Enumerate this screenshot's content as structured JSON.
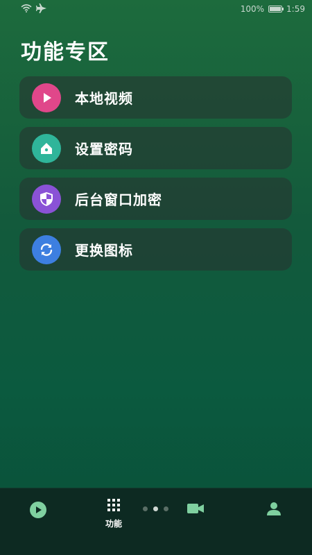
{
  "status_bar": {
    "battery_percent": "100%",
    "time": "1:59",
    "icons": [
      "wifi-icon",
      "airplane-icon",
      "battery-icon"
    ]
  },
  "page_title": "功能专区",
  "menu": [
    {
      "label": "本地视频",
      "icon": "play-icon",
      "color": "#e0478a"
    },
    {
      "label": "设置密码",
      "icon": "home-lock-icon",
      "color": "#2fb59a"
    },
    {
      "label": "后台窗口加密",
      "icon": "shield-icon",
      "color": "#8a52d6"
    },
    {
      "label": "更换图标",
      "icon": "refresh-icon",
      "color": "#3d7fe0"
    }
  ],
  "bottom_nav": {
    "items": [
      {
        "icon": "play-icon",
        "label": ""
      },
      {
        "icon": "grid-icon",
        "label": "功能"
      },
      {
        "icon": "video-camera-icon",
        "label": ""
      },
      {
        "icon": "user-icon",
        "label": ""
      }
    ],
    "accent": "#7fd0a0",
    "pager_active_index": 1
  }
}
